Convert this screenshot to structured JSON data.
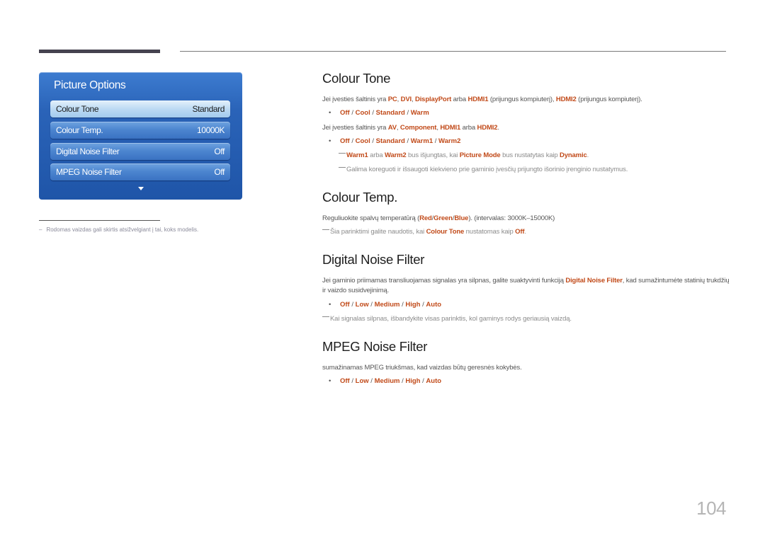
{
  "osd": {
    "title": "Picture Options",
    "items": [
      {
        "label": "Colour Tone",
        "value": "Standard",
        "selected": true
      },
      {
        "label": "Colour Temp.",
        "value": "10000K",
        "selected": false
      },
      {
        "label": "Digital Noise Filter",
        "value": "Off",
        "selected": false
      },
      {
        "label": "MPEG Noise Filter",
        "value": "Off",
        "selected": false
      }
    ],
    "more_icon": "chevron-down-icon"
  },
  "footnote": {
    "dash": "–",
    "text": "Rodomas vaizdas gali skirtis atsižvelgiant į tai, koks modelis."
  },
  "sections": {
    "colour_tone": {
      "heading": "Colour Tone",
      "p1": {
        "t1": "Jei įvesties šaltinis yra ",
        "pc": "PC",
        "c1": ", ",
        "dvi": "DVI",
        "c2": ", ",
        "dp": "DisplayPort",
        "t2": " arba ",
        "hdmi1": "HDMI1",
        "t3": " (prijungus kompiuterį), ",
        "hdmi2": "HDMI2",
        "t4": " (prijungus kompiuterį)."
      },
      "options1": [
        "Off",
        "Cool",
        "Standard",
        "Warm"
      ],
      "p2": {
        "t1": "Jei įvesties šaltinis yra ",
        "av": "AV",
        "c1": ", ",
        "comp": "Component",
        "c2": ", ",
        "hdmi1": "HDMI1",
        "t2": " arba ",
        "hdmi2": "HDMI2",
        "t3": "."
      },
      "options2": [
        "Off",
        "Cool",
        "Standard",
        "Warm1",
        "Warm2"
      ],
      "note1": {
        "warm1": "Warm1",
        "t1": " arba ",
        "warm2": "Warm2",
        "t2": " bus išjungtas, kai ",
        "pm": "Picture Mode",
        "t3": " bus nustatytas kaip ",
        "dyn": "Dynamic",
        "t4": "."
      },
      "note2": "Galima koreguoti ir išsaugoti kiekvieno prie gaminio įvesčių prijungto išorinio įrenginio nustatymus."
    },
    "colour_temp": {
      "heading": "Colour Temp.",
      "p1": {
        "t1": "Reguliuokite spalvų temperatūrą (",
        "red": "Red",
        "s1": "/",
        "green": "Green",
        "s2": "/",
        "blue": "Blue",
        "t2": "). (intervalas: 3000K–15000K)"
      },
      "note1": {
        "t1": "Šia parinktimi galite naudotis, kai ",
        "ct": "Colour Tone",
        "t2": " nustatomas kaip ",
        "off": "Off",
        "t3": "."
      }
    },
    "digital_noise": {
      "heading": "Digital Noise Filter",
      "p1": {
        "t1": "Jei gaminio priimamas transliuojamas signalas yra silpnas, galite suaktyvinti funkciją ",
        "dnf": "Digital Noise Filter",
        "t2": ", kad sumažintumėte statinių trukdžių ir vaizdo susidvejinimą."
      },
      "options": [
        "Off",
        "Low",
        "Medium",
        "High",
        "Auto"
      ],
      "note1": "Kai signalas silpnas, išbandykite visas parinktis, kol gaminys rodys geriausią vaizdą."
    },
    "mpeg_noise": {
      "heading": "MPEG Noise Filter",
      "p1": "sumažinamas MPEG triukšmas, kad vaizdas būtų geresnės kokybės.",
      "options": [
        "Off",
        "Low",
        "Medium",
        "High",
        "Auto"
      ]
    }
  },
  "bullet_char": "•",
  "option_separator": " / ",
  "page_number": "104",
  "colors": {
    "highlight": "#c14a19",
    "osd_blue": "#2a63b8",
    "heading": "#1e1e1e"
  }
}
